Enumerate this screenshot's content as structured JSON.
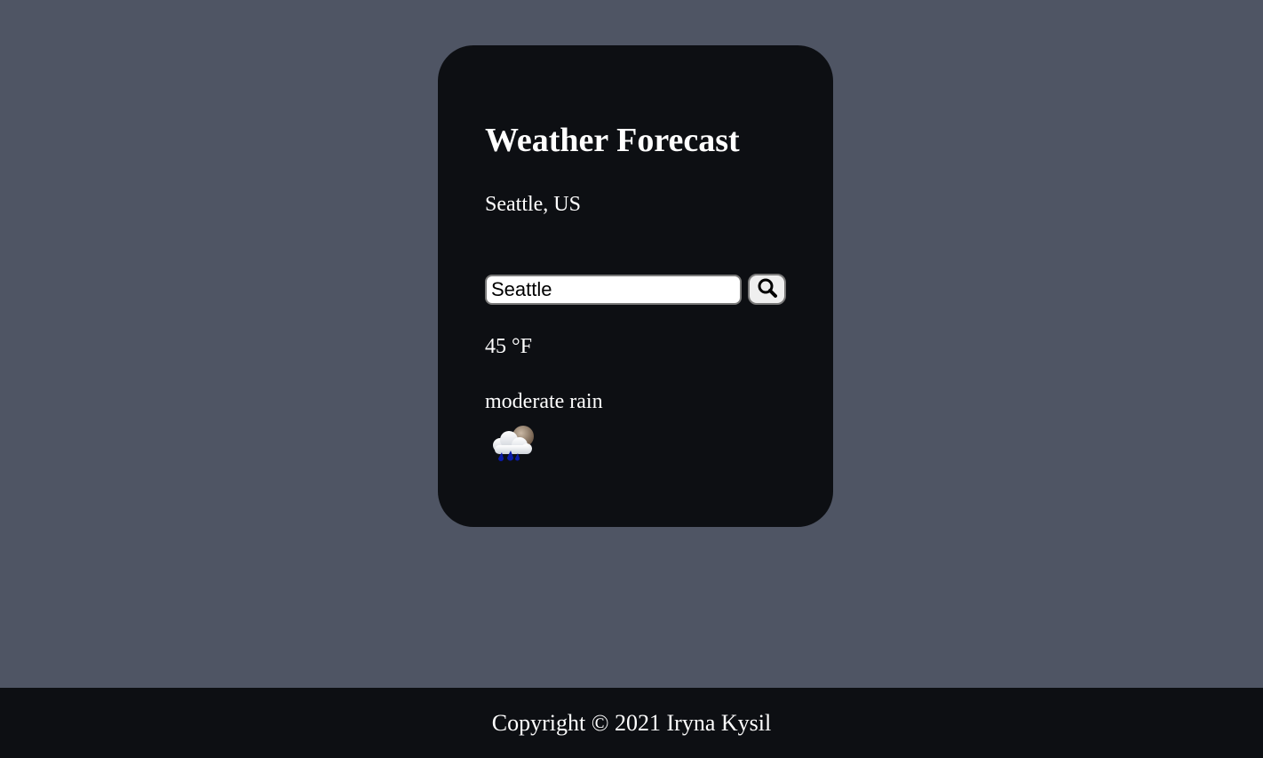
{
  "card": {
    "title": "Weather Forecast",
    "location": "Seattle, US",
    "search": {
      "value": "Seattle",
      "button_icon": "search-icon"
    },
    "temperature": "45 °F",
    "description": "moderate rain",
    "weather_icon": "rain-cloud-moon-icon"
  },
  "footer": {
    "copyright": "Copyright © 2021 Iryna Kysil"
  },
  "colors": {
    "page_background": "#4f5564",
    "card_background": "#0d0f13",
    "footer_background": "#0d0f13",
    "text": "#ffffff"
  }
}
